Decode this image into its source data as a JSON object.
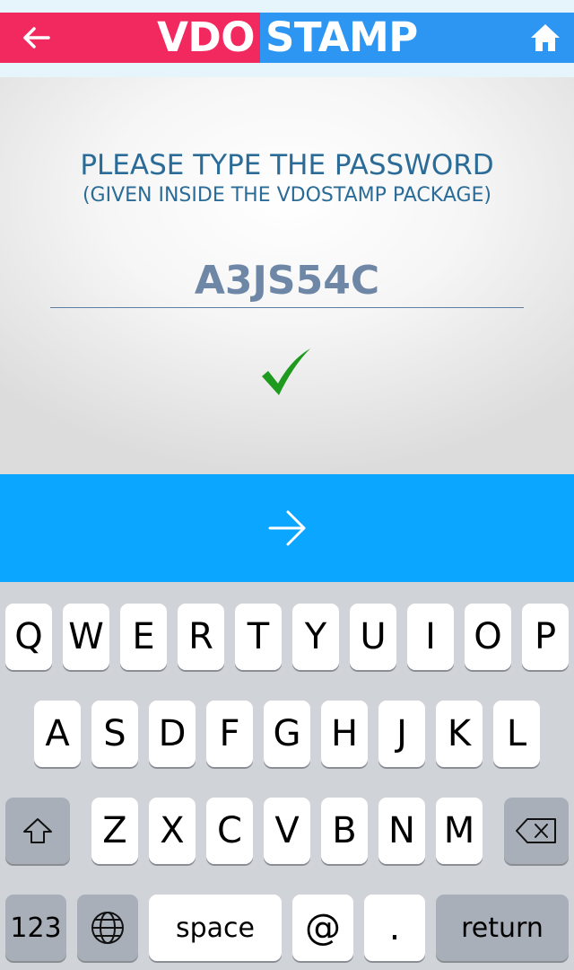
{
  "header": {
    "logo_part1": "VDO",
    "logo_part2": "STAMP",
    "back_icon": "arrow-left-icon",
    "home_icon": "home-icon",
    "colors": {
      "left": "#f2295f",
      "right": "#2d96f3"
    }
  },
  "main": {
    "prompt": "PLEASE TYPE THE PASSWORD",
    "subprompt": "(GIVEN INSIDE THE VDOSTAMP PACKAGE)",
    "password_value": "A3JS54C",
    "status_icon": "checkmark-icon",
    "status_color": "#1e9a1e"
  },
  "next_button": {
    "icon": "arrow-right-icon",
    "color": "#0ba6ff"
  },
  "keyboard": {
    "row1": [
      "Q",
      "W",
      "E",
      "R",
      "T",
      "Y",
      "U",
      "I",
      "O",
      "P"
    ],
    "row2": [
      "A",
      "S",
      "D",
      "F",
      "G",
      "H",
      "J",
      "K",
      "L"
    ],
    "row3": [
      "Z",
      "X",
      "C",
      "V",
      "B",
      "N",
      "M"
    ],
    "shift_icon": "shift-icon",
    "backspace_icon": "backspace-icon",
    "numbers_label": "123",
    "globe_icon": "globe-icon",
    "space_label": "space",
    "at_label": "@",
    "dot_label": ".",
    "return_label": "return"
  }
}
